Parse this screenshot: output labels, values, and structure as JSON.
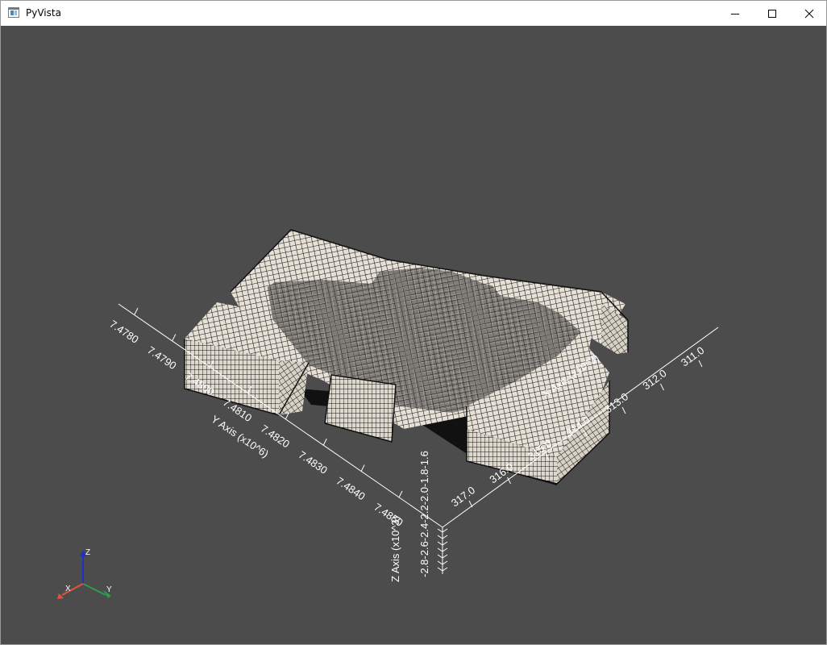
{
  "window": {
    "title": "PyVista"
  },
  "scene": {
    "background": "#4c4c4c",
    "mesh_face_color": "#e6e0d6",
    "mesh_edge_color": "#111111",
    "y_axis": {
      "title": "Y Axis (x10^6)",
      "ticks": [
        "7.4780",
        "7.4790",
        "7.4800",
        "7.4810",
        "7.4820",
        "7.4830",
        "7.4840",
        "7.4850"
      ]
    },
    "x_axis": {
      "title": "X Axis (x10^3)",
      "ticks": [
        "317.0",
        "316.0",
        "315.0",
        "314.0",
        "313.0",
        "312.0",
        "311.0"
      ]
    },
    "z_axis": {
      "title": "Z Axis (x10^3)",
      "ticks_text": "-2.8-2.6-2.4-2.2-2.0-1.8-1.6"
    },
    "orientation_widget": {
      "x_label": "X",
      "y_label": "Y",
      "z_label": "Z",
      "x_color": "#e8503c",
      "y_color": "#2e9a4c",
      "z_color": "#1f2fd0"
    }
  }
}
